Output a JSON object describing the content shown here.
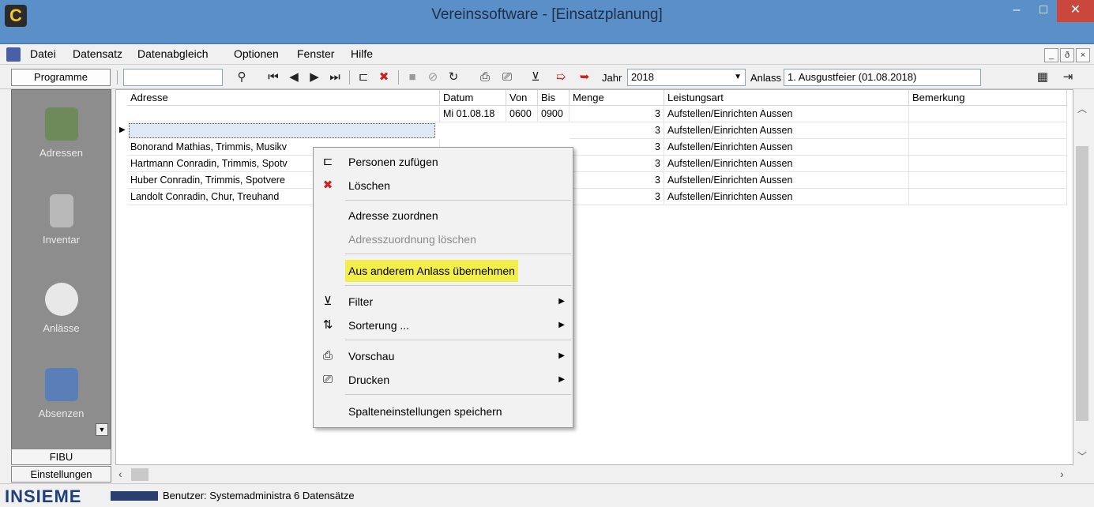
{
  "window": {
    "title": "Vereinssoftware - [Einsatzplanung]",
    "minimize": "–",
    "maximize": "□",
    "close": "✕"
  },
  "menu": [
    "Datei",
    "Datensatz",
    "Datenabgleich",
    "Optionen",
    "Fenster",
    "Hilfe"
  ],
  "mdi": {
    "minimize": "_",
    "restore": "ð",
    "close": "×"
  },
  "toolbar": {
    "programs_header": "Programme",
    "search_value": "",
    "year_label": "Jahr",
    "year_value": "2018",
    "event_label": "Anlass",
    "event_value": "1. Ausgustfeier (01.08.2018)"
  },
  "sidebar": {
    "items": [
      "Adressen",
      "Inventar",
      "Anlässe",
      "Absenzen"
    ],
    "tabs": [
      "FIBU",
      "Einstellungen"
    ]
  },
  "grid": {
    "columns": [
      "Adresse",
      "Datum",
      "Von",
      "Bis",
      "Menge",
      "Leistungsart",
      "Bemerkung"
    ],
    "rows": [
      {
        "adresse": "",
        "datum": "Mi 01.08.18",
        "von": "0600",
        "bis": "0900",
        "menge": "3",
        "leistungsart": "Aufstellen/Einrichten Aussen",
        "bemerkung": ""
      },
      {
        "adresse": "",
        "datum": "",
        "von": "",
        "bis": "",
        "menge": "3",
        "leistungsart": "Aufstellen/Einrichten Aussen",
        "bemerkung": ""
      },
      {
        "adresse": "Bonorand Mathias, Trimmis, Musikv",
        "datum": "",
        "von": "",
        "bis": "",
        "menge": "3",
        "leistungsart": "Aufstellen/Einrichten Aussen",
        "bemerkung": ""
      },
      {
        "adresse": "Hartmann Conradin, Trimmis, Spotv",
        "datum": "",
        "von": "",
        "bis": "",
        "menge": "3",
        "leistungsart": "Aufstellen/Einrichten Aussen",
        "bemerkung": ""
      },
      {
        "adresse": "Huber Conradin, Trimmis, Spotvere",
        "datum": "",
        "von": "",
        "bis": "",
        "menge": "3",
        "leistungsart": "Aufstellen/Einrichten Aussen",
        "bemerkung": ""
      },
      {
        "adresse": "Landolt Conradin, Chur, Treuhand",
        "datum": "",
        "von": "",
        "bis": "",
        "menge": "3",
        "leistungsart": "Aufstellen/Einrichten Aussen",
        "bemerkung": ""
      }
    ]
  },
  "context_menu": {
    "items": [
      {
        "label": "Personen zufügen",
        "icon": "add-person-icon"
      },
      {
        "label": "Löschen",
        "icon": "delete-icon"
      },
      {
        "label": "Adresse zuordnen"
      },
      {
        "label": "Adresszuordnung löschen",
        "disabled": true
      },
      {
        "label": "Aus anderem Anlass übernehmen",
        "highlighted": true
      },
      {
        "label": "Filter",
        "icon": "filter-icon",
        "submenu": true
      },
      {
        "label": "Sorterung ...",
        "icon": "sort-icon",
        "submenu": true
      },
      {
        "label": "Vorschau",
        "icon": "preview-icon",
        "submenu": true
      },
      {
        "label": "Drucken",
        "icon": "print-icon",
        "submenu": true
      },
      {
        "label": "Spalteneinstellungen speichern"
      }
    ]
  },
  "status": {
    "brand": "INSIEME",
    "user": "Benutzer: Systemadministra",
    "records": "6 Datensätze"
  },
  "colors": {
    "highlight": "#f2ef4d",
    "titlebar": "#5b8fc7",
    "close": "#c9473d",
    "sidebar": "#8d8d8d"
  }
}
